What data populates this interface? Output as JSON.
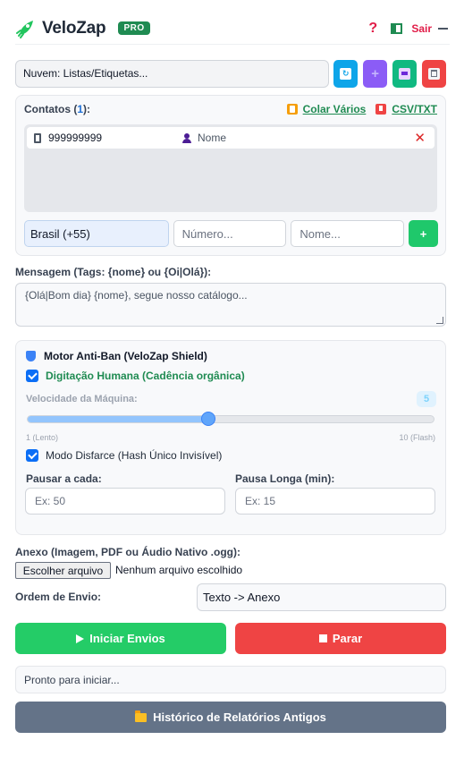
{
  "header": {
    "logo_text": "VeloZap",
    "badge": "PRO",
    "help_icon": "?",
    "logout_label": "Sair"
  },
  "list": {
    "selected": "Nuvem: Listas/Etiquetas...",
    "icons": [
      "refresh-icon",
      "add-list-icon",
      "save-icon",
      "delete-icon"
    ]
  },
  "contacts": {
    "label": "Contatos (",
    "count": "1",
    "label_end": "):",
    "paste_label": "Colar Vários",
    "csv_label": "CSV/TXT",
    "items": [
      {
        "number": "999999999",
        "name": "Nome"
      }
    ],
    "country": "Brasil (+55)",
    "number_placeholder": "Número...",
    "name_placeholder": "Nome...",
    "add_label": "+"
  },
  "message": {
    "label": "Mensagem (Tags: {nome} ou {Oi|Olá}):",
    "placeholder": "{Olá|Bom dia} {nome}, segue nosso catálogo..."
  },
  "antiban": {
    "title": "Motor Anti-Ban (VeloZap Shield)",
    "human_typing_label": "Digitação Humana (Cadência orgânica)",
    "human_typing_checked": true,
    "speed_label": "Velocidade da Máquina:",
    "speed_value": "5",
    "speed_min": 1,
    "speed_max": 10,
    "speed_min_label": "1 (Lento)",
    "speed_max_label": "10 (Flash)",
    "disguise_label": "Modo Disfarce (Hash Único Invisível)",
    "disguise_checked": true,
    "pause_every_label": "Pausar a cada:",
    "pause_every_placeholder": "Ex: 50",
    "long_pause_label": "Pausa Longa (min):",
    "long_pause_placeholder": "Ex: 15"
  },
  "attachment": {
    "label": "Anexo (Imagem, PDF ou Áudio Nativo .ogg):",
    "button_label": "Escolher arquivo",
    "status": "Nenhum arquivo escolhido"
  },
  "order": {
    "label": "Ordem de Envio:",
    "selected": "Texto -> Anexo"
  },
  "actions": {
    "start_label": "Iniciar Envios",
    "stop_label": "Parar",
    "status_text": "Pronto para iniciar...",
    "history_label": "Histórico de Relatórios Antigos"
  },
  "colors": {
    "brand_green": "#1f8b52",
    "start_green": "#24cc67",
    "stop_red": "#ef4444",
    "history_slate": "#647388",
    "checkbox_blue": "#0b6ef6"
  }
}
